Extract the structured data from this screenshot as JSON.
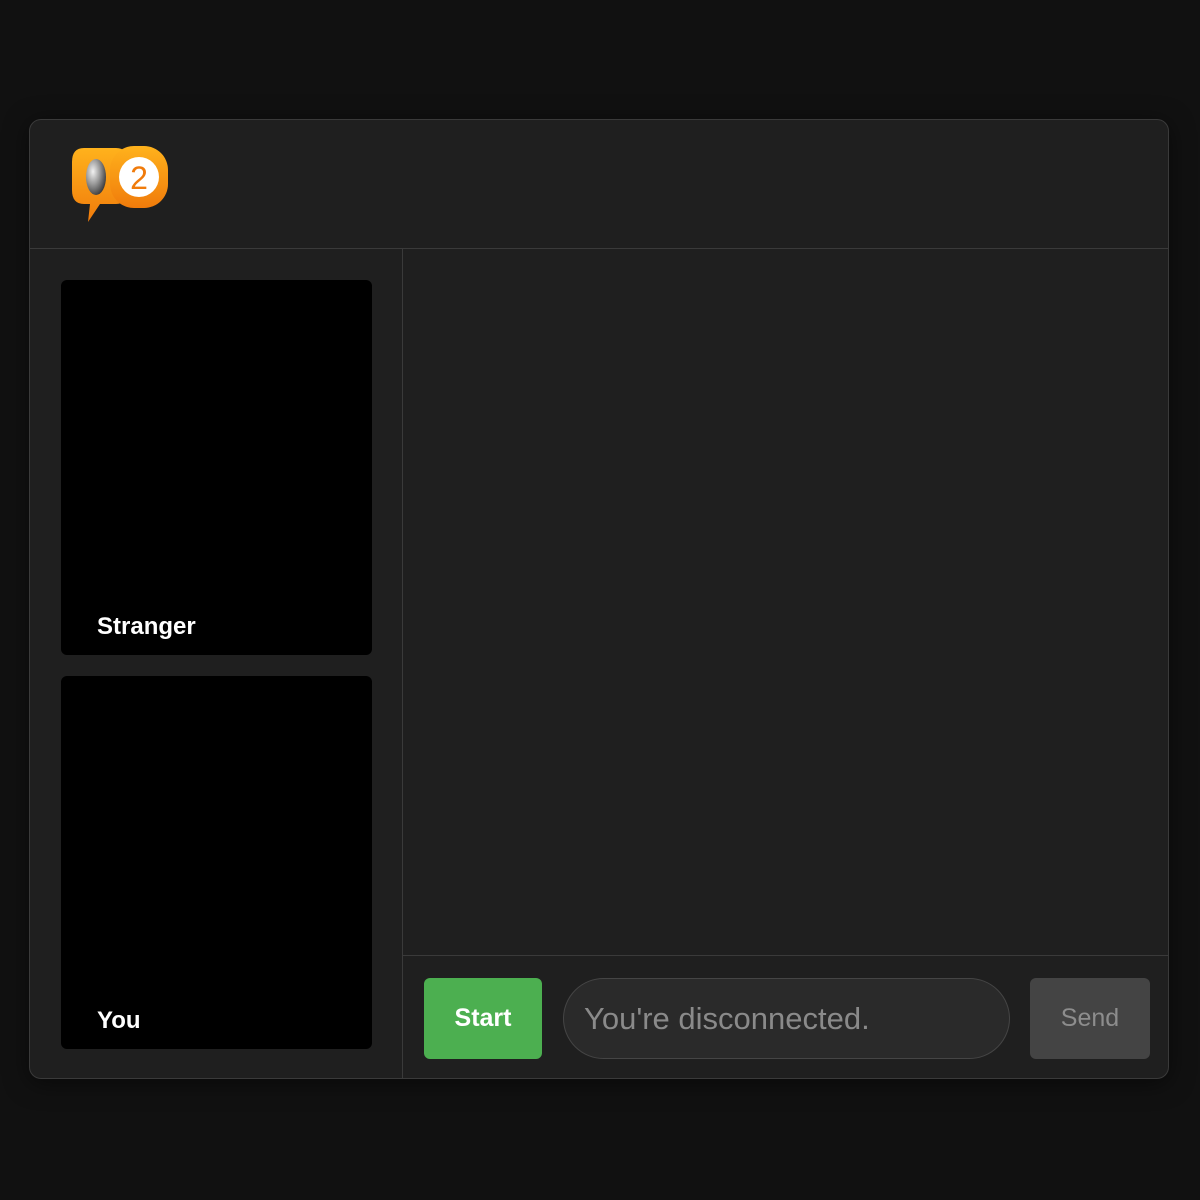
{
  "header": {
    "logo_icon": "chat-bubbles-logo-icon",
    "logo_number": "2"
  },
  "videos": {
    "stranger_label": "Stranger",
    "you_label": "You"
  },
  "controls": {
    "start_label": "Start",
    "input_placeholder": "You're disconnected.",
    "send_label": "Send"
  },
  "colors": {
    "start_button": "#4caf50",
    "logo_orange": "#f7931e",
    "send_button_disabled": "#444444"
  }
}
